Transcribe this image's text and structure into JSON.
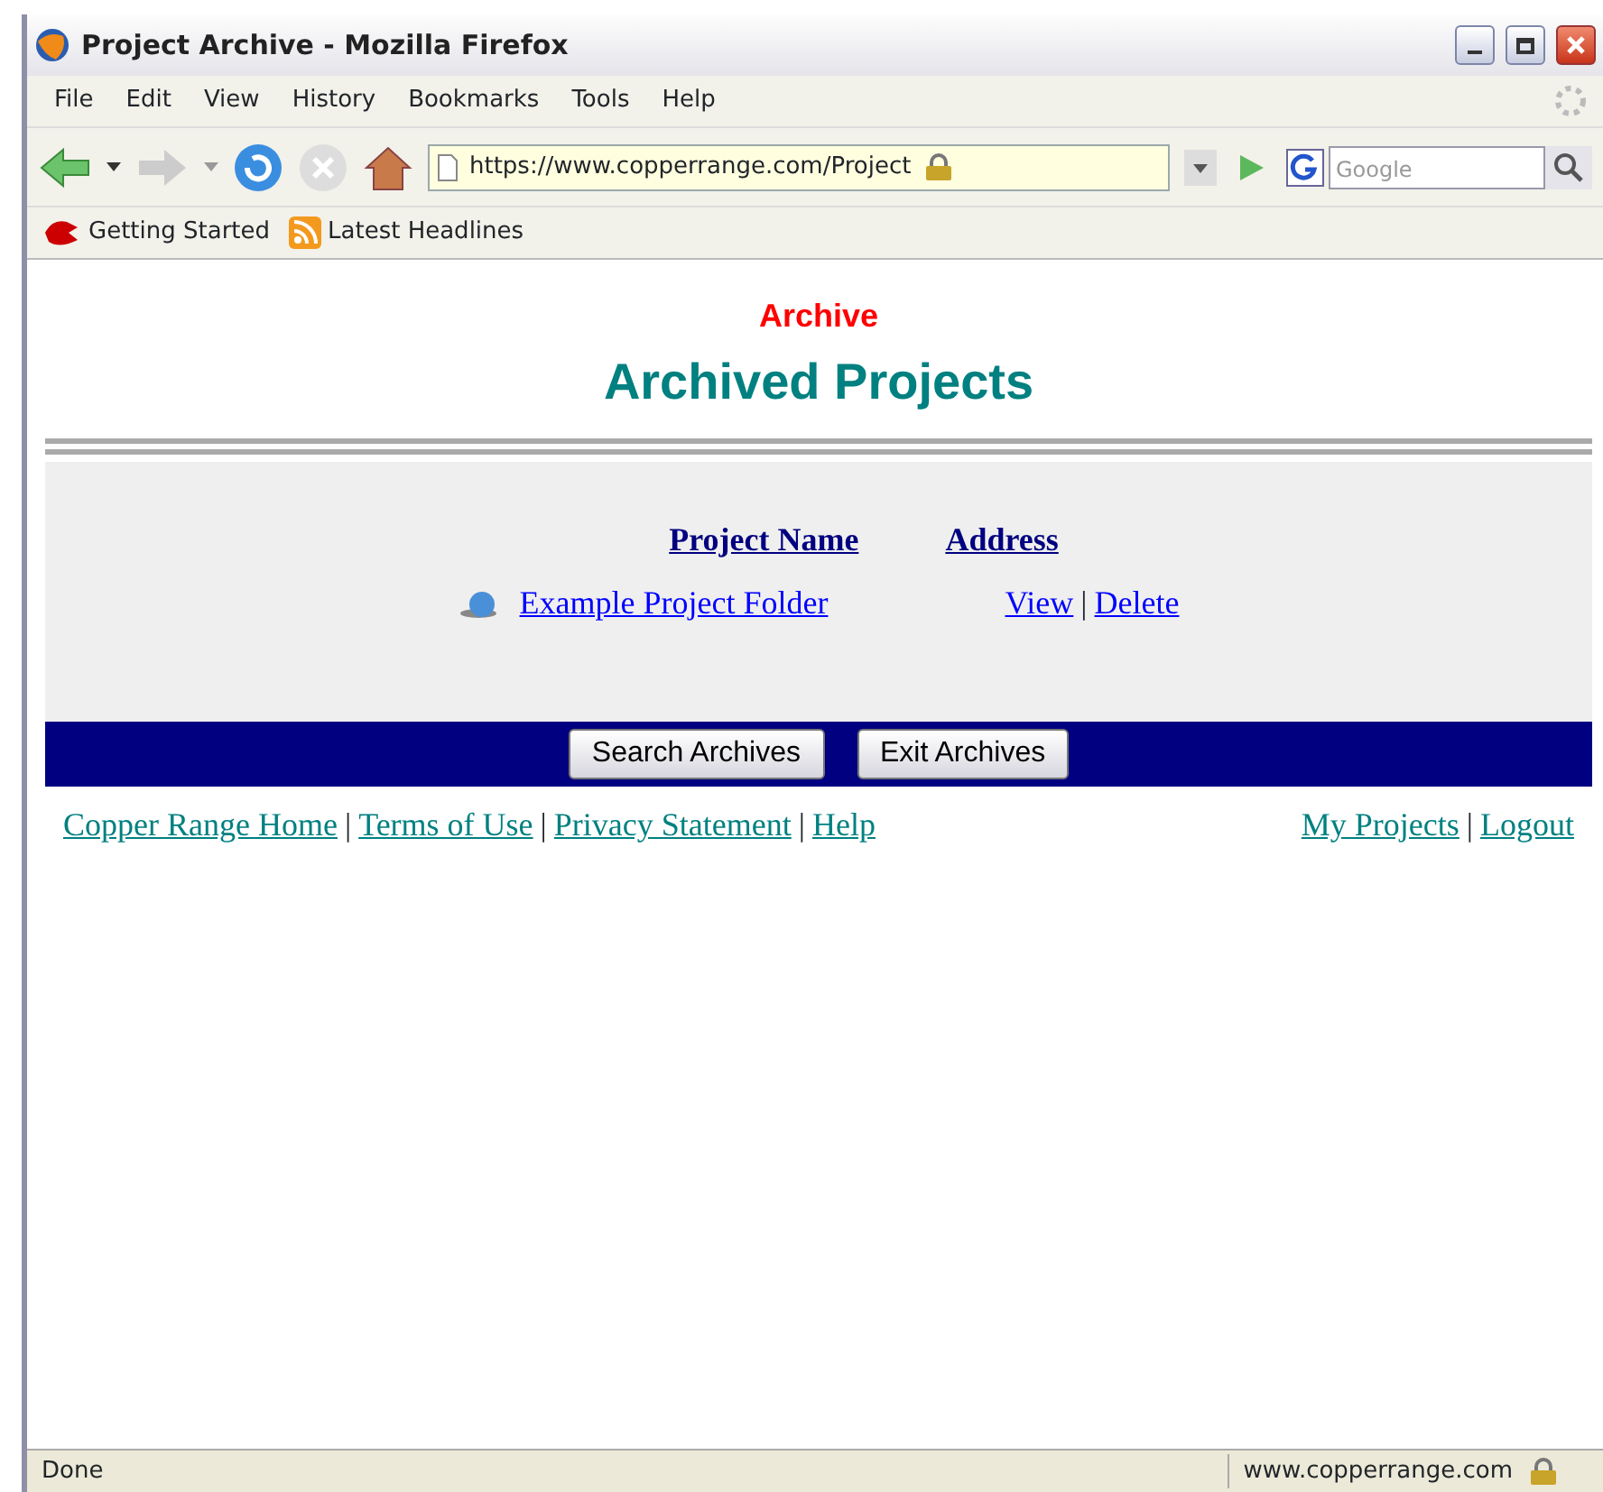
{
  "window": {
    "title": "Project Archive - Mozilla Firefox"
  },
  "menu": [
    "File",
    "Edit",
    "View",
    "History",
    "Bookmarks",
    "Tools",
    "Help"
  ],
  "address_bar": {
    "url": "https://www.copperrange.com/Project"
  },
  "search": {
    "placeholder": "Google"
  },
  "bookmarks": [
    {
      "label": "Getting Started",
      "kind": "start"
    },
    {
      "label": "Latest Headlines",
      "kind": "feed"
    }
  ],
  "page": {
    "section": "Archive",
    "heading": "Archived Projects",
    "columns": [
      "Project Name",
      "Address"
    ],
    "rows": [
      {
        "name": "Example Project Folder",
        "actions": [
          {
            "kind": "link",
            "text": "View"
          },
          {
            "kind": "separator",
            "text": "|"
          },
          {
            "kind": "link",
            "text": "Delete"
          }
        ]
      }
    ],
    "buttons": [
      "Search Archives",
      "Exit Archives"
    ],
    "footer_left": [
      {
        "kind": "link",
        "text": "Copper Range Home"
      },
      {
        "kind": "separator",
        "text": "|"
      },
      {
        "kind": "link",
        "text": "Terms of Use"
      },
      {
        "kind": "separator",
        "text": "|"
      },
      {
        "kind": "link",
        "text": "Privacy Statement"
      },
      {
        "kind": "separator",
        "text": "|"
      },
      {
        "kind": "link",
        "text": "Help"
      }
    ],
    "footer_right": [
      {
        "kind": "link",
        "text": "My Projects"
      },
      {
        "kind": "separator",
        "text": "|"
      },
      {
        "kind": "link",
        "text": "Logout"
      }
    ]
  },
  "status_bar": {
    "text": "Done",
    "host": "www.copperrange.com"
  }
}
